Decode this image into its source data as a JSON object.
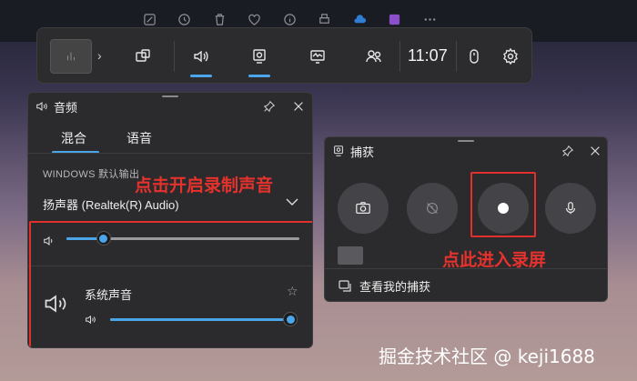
{
  "time": "11:07",
  "audio_panel": {
    "title": "音频",
    "tabs": [
      {
        "label": "混合"
      },
      {
        "label": "语音"
      }
    ],
    "output_label": "WINDOWS 默认输出",
    "device": "扬声器 (Realtek(R) Audio)",
    "master_volume": 0.16,
    "app": {
      "name": "系统声音",
      "volume": 1.0
    }
  },
  "capture_panel": {
    "title": "捕获",
    "view_captures": "查看我的捕获"
  },
  "annotations": {
    "audio": "点击开启录制声音",
    "record": "点此进入录屏"
  },
  "watermark": "掘金技术社区 @ keji1688",
  "colors": {
    "accent": "#4aa6e8",
    "annotation": "#e2302d"
  }
}
